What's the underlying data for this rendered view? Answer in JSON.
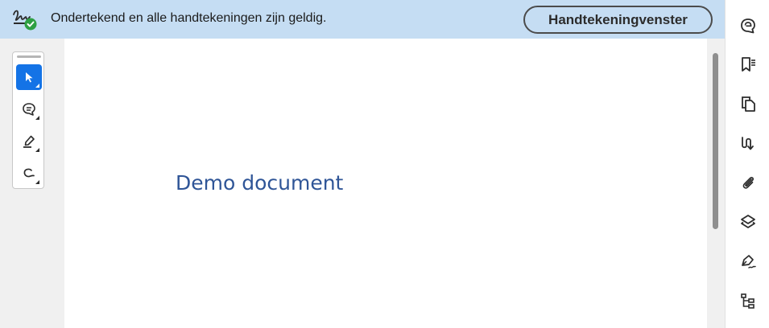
{
  "signature_bar": {
    "message": "Ondertekend en alle handtekeningen zijn geldig.",
    "panel_button_label": "Handtekeningvenster",
    "status_icon": "signature-valid-icon",
    "status_color": "#2ea043",
    "background_color": "#c5ddf3"
  },
  "document": {
    "title": "Demo document",
    "title_color": "#2f5597"
  },
  "left_toolbar": {
    "tools": [
      {
        "icon": "select-cursor-icon",
        "active": true
      },
      {
        "icon": "comment-icon",
        "active": false
      },
      {
        "icon": "highlight-pen-icon",
        "active": false
      },
      {
        "icon": "freehand-draw-icon",
        "active": false
      }
    ],
    "accent_color": "#1473e6"
  },
  "right_rail": {
    "buttons": [
      {
        "icon": "comments-panel-icon"
      },
      {
        "icon": "bookmarks-icon"
      },
      {
        "icon": "page-thumbnails-icon"
      },
      {
        "icon": "order-pages-icon"
      },
      {
        "icon": "attachments-icon"
      },
      {
        "icon": "layers-icon"
      },
      {
        "icon": "fill-sign-icon"
      },
      {
        "icon": "content-tree-icon"
      }
    ]
  }
}
